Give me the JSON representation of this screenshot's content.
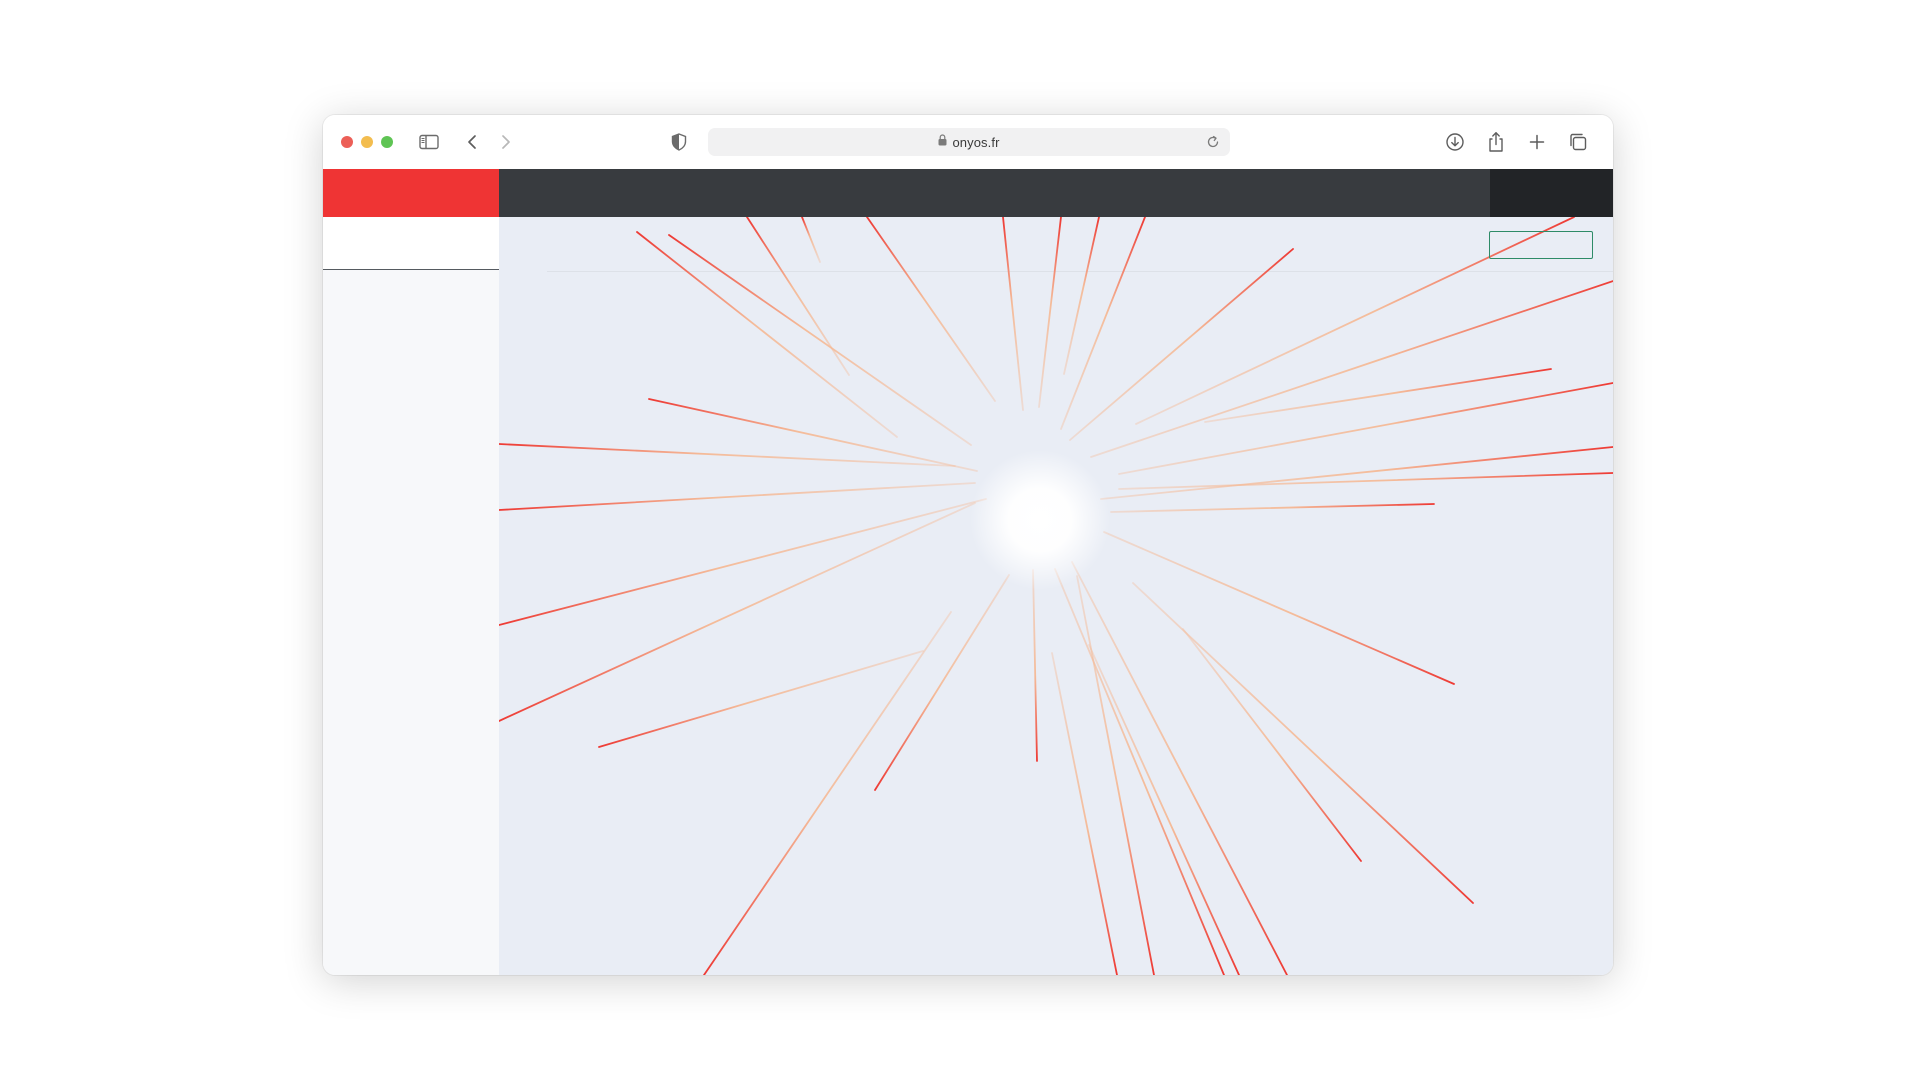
{
  "browser": {
    "url": "onyos.fr",
    "colors": {
      "close": "#ec5f57",
      "minimize": "#f3bd4f",
      "zoom": "#5fc454"
    },
    "icons": {
      "sidebar": "sidebar-icon",
      "back": "chevron-left-icon",
      "forward": "chevron-right-icon",
      "privacy": "shield-icon",
      "lock": "lock-icon",
      "reload": "reload-icon",
      "download": "download-icon",
      "share": "share-icon",
      "new_tab": "plus-icon",
      "tabs": "tabs-overview-icon"
    }
  },
  "page": {
    "colors": {
      "brand": "#ef3434",
      "nav": "#383b3f",
      "nav_right": "#222427",
      "main_bg": "#e9edf5",
      "sidebar_bg": "#f7f8fa",
      "button_border": "#2e8b67",
      "burst_red": "#ee3a34",
      "burst_peach": "#f5b995"
    },
    "loading_animation": "radial-burst"
  }
}
